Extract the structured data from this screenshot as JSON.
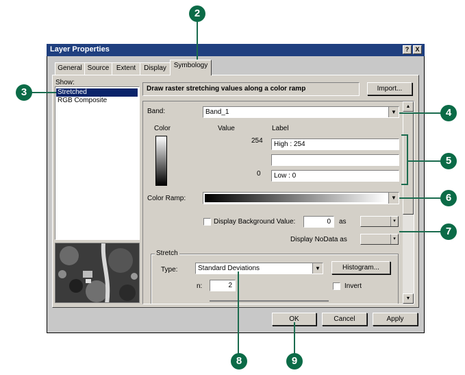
{
  "window": {
    "title": "Layer Properties",
    "help_btn": "?",
    "close_btn": "X"
  },
  "tabs": [
    {
      "label": "General"
    },
    {
      "label": "Source"
    },
    {
      "label": "Extent"
    },
    {
      "label": "Display"
    },
    {
      "label": "Symbology"
    }
  ],
  "show": {
    "label": "Show:",
    "items": [
      {
        "label": "Stretched",
        "selected": true
      },
      {
        "label": "RGB Composite",
        "selected": false
      }
    ]
  },
  "description": "Draw raster stretching values along a color ramp",
  "import_btn": "Import...",
  "band": {
    "label": "Band:",
    "value": "Band_1"
  },
  "columns": {
    "color": "Color",
    "value": "Value",
    "label": "Label"
  },
  "rows": [
    {
      "value": "254",
      "label": "High : 254"
    },
    {
      "value": "",
      "label": ""
    },
    {
      "value": "0",
      "label": "Low : 0"
    }
  ],
  "color_ramp": {
    "label": "Color Ramp:"
  },
  "background": {
    "checkbox_label": "Display Background Value:",
    "value": "0",
    "as_label": "as"
  },
  "nodata": {
    "label": "Display NoData as"
  },
  "stretch": {
    "group_label": "Stretch",
    "type_label": "Type:",
    "type_value": "Standard Deviations",
    "histogram_btn": "Histogram...",
    "n_label": "n:",
    "n_value": "2",
    "invert_label": "Invert"
  },
  "buttons": {
    "ok": "OK",
    "cancel": "Cancel",
    "apply": "Apply"
  },
  "callouts": [
    "2",
    "3",
    "4",
    "5",
    "6",
    "7",
    "8",
    "9"
  ],
  "colors": {
    "callout": "#0b6b47",
    "titlebar": "#1f3f7f",
    "selection": "#0a246a"
  }
}
